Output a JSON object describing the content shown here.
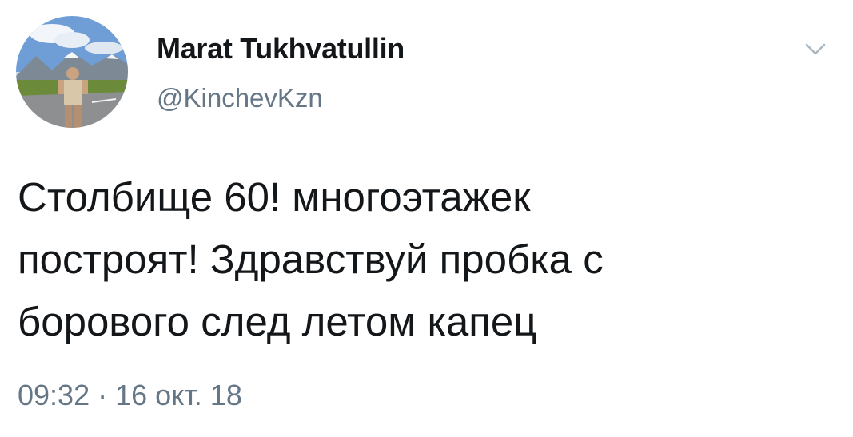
{
  "author": {
    "display_name": "Marat Tukhvatullin",
    "handle": "@KinchevKzn",
    "avatar_icon": "profile-photo"
  },
  "menu": {
    "icon": "chevron-down-icon"
  },
  "tweet": {
    "lines": [
      "Столбище 60! многоэтажек",
      "построят! Здравствуй пробка с",
      "борового след летом капец"
    ],
    "timestamp": "09:32 · 16 окт. 18"
  },
  "colors": {
    "text_primary": "#14171a",
    "text_secondary": "#657786",
    "background": "#ffffff"
  }
}
